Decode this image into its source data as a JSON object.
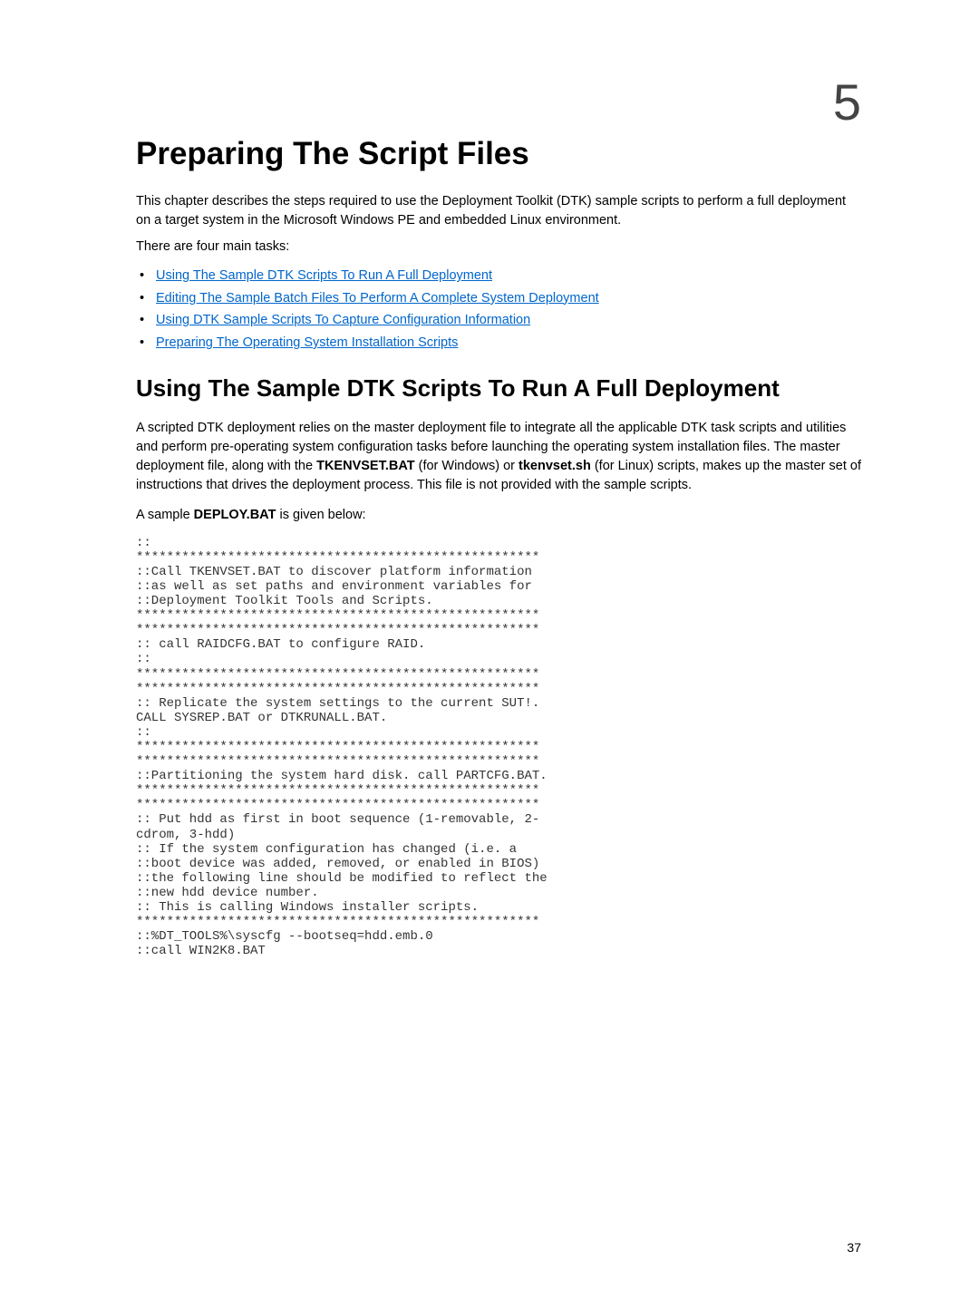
{
  "chapter_number": "5",
  "title": "Preparing The Script Files",
  "intro": "This chapter describes the steps required to use the Deployment Toolkit (DTK) sample scripts to perform a full deployment on a target system in the Microsoft Windows PE and embedded Linux environment.",
  "tasks_intro": "There are four main tasks:",
  "tasks": [
    "Using The Sample DTK Scripts To Run A Full Deployment",
    "Editing The Sample Batch Files To Perform A Complete System Deployment",
    "Using DTK Sample Scripts To Capture Configuration Information",
    "Preparing The Operating System Installation Scripts"
  ],
  "section_heading": "Using The Sample DTK Scripts To Run A Full Deployment",
  "section_body_1a": "A scripted DTK deployment relies on the master deployment file to integrate all the applicable DTK task scripts and utilities and perform pre-operating system configuration tasks before launching the operating system installation files. The master deployment file, along with the ",
  "section_body_1_bold1": "TKENVSET.BAT",
  "section_body_1b": " (for Windows) or ",
  "section_body_1_bold2": "tkenvset.sh",
  "section_body_1c": " (for Linux) scripts, makes up the master set of instructions that drives the deployment process. This file is not provided with the sample scripts.",
  "sample_line_a": "A sample ",
  "sample_line_bold": "DEPLOY.BAT",
  "sample_line_b": " is given below:",
  "code": ":: \n*****************************************************\n::Call TKENVSET.BAT to discover platform information \n::as well as set paths and environment variables for \n::Deployment Toolkit Tools and Scripts.\n*****************************************************\n*****************************************************\n:: call RAIDCFG.BAT to configure RAID.\n:: \n*****************************************************\n*****************************************************\n:: Replicate the system settings to the current SUT!. \nCALL SYSREP.BAT or DTKRUNALL.BAT.\n:: \n*****************************************************\n*****************************************************\n::Partitioning the system hard disk. call PARTCFG.BAT.\n*****************************************************\n*****************************************************\n:: Put hdd as first in boot sequence (1-removable, 2-\ncdrom, 3-hdd)\n:: If the system configuration has changed (i.e. a \n::boot device was added, removed, or enabled in BIOS) \n::the following line should be modified to reflect the \n::new hdd device number.\n:: This is calling Windows installer scripts.\n*****************************************************\n::%DT_TOOLS%\\syscfg --bootseq=hdd.emb.0\n::call WIN2K8.BAT",
  "page_number": "37"
}
